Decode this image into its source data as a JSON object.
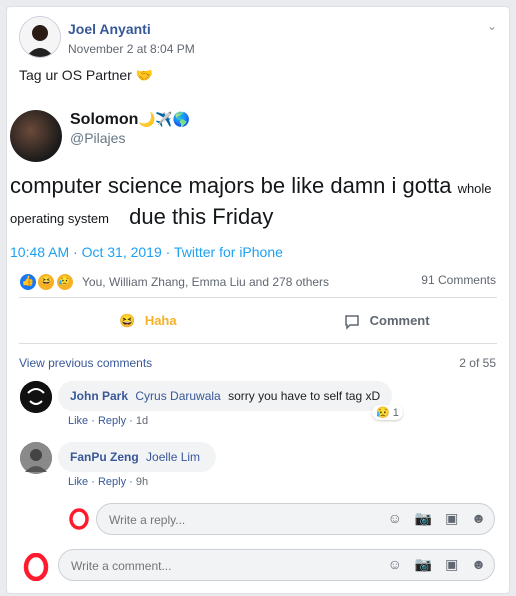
{
  "post": {
    "author": "Joel Anyanti",
    "timestamp": "November 2 at 8:04 PM",
    "text": "Tag ur OS Partner",
    "emoji": "🤝"
  },
  "tweet": {
    "name": "Solomon",
    "handle": "@Pilajes",
    "name_emojis": "🌙✈️🌎",
    "line1_large": "computer science majors be like damn i gotta",
    "line1_small": "whole",
    "line2_small": "operating system",
    "line2_large": "due this Friday",
    "time": "10:48 AM · Oct 31, 2019",
    "via": "Twitter for iPhone"
  },
  "reactions": {
    "summary": "You, William Zhang, Emma Liu and 278 others",
    "comments_count": "91 Comments"
  },
  "actions": {
    "haha": "Haha",
    "comment": "Comment"
  },
  "comments_header": {
    "view_previous": "View previous comments",
    "position": "2 of 55"
  },
  "comments": [
    {
      "author": "John Park",
      "tag": "Cyrus Daruwala",
      "text": "sorry you have to self tag xD",
      "like": "Like",
      "reply": "Reply",
      "time": "1d",
      "reaction_count": "1"
    },
    {
      "author": "FanPu Zeng",
      "tag": "Joelle Lim",
      "text": "",
      "like": "Like",
      "reply": "Reply",
      "time": "9h"
    }
  ],
  "reply_input": {
    "placeholder": "Write a reply..."
  },
  "comment_input": {
    "placeholder": "Write a comment..."
  },
  "colors": {
    "link": "#385898",
    "accent_haha": "#f7b125",
    "twitter_blue": "#1da1f2",
    "opera_red": "#ff1b2d"
  }
}
